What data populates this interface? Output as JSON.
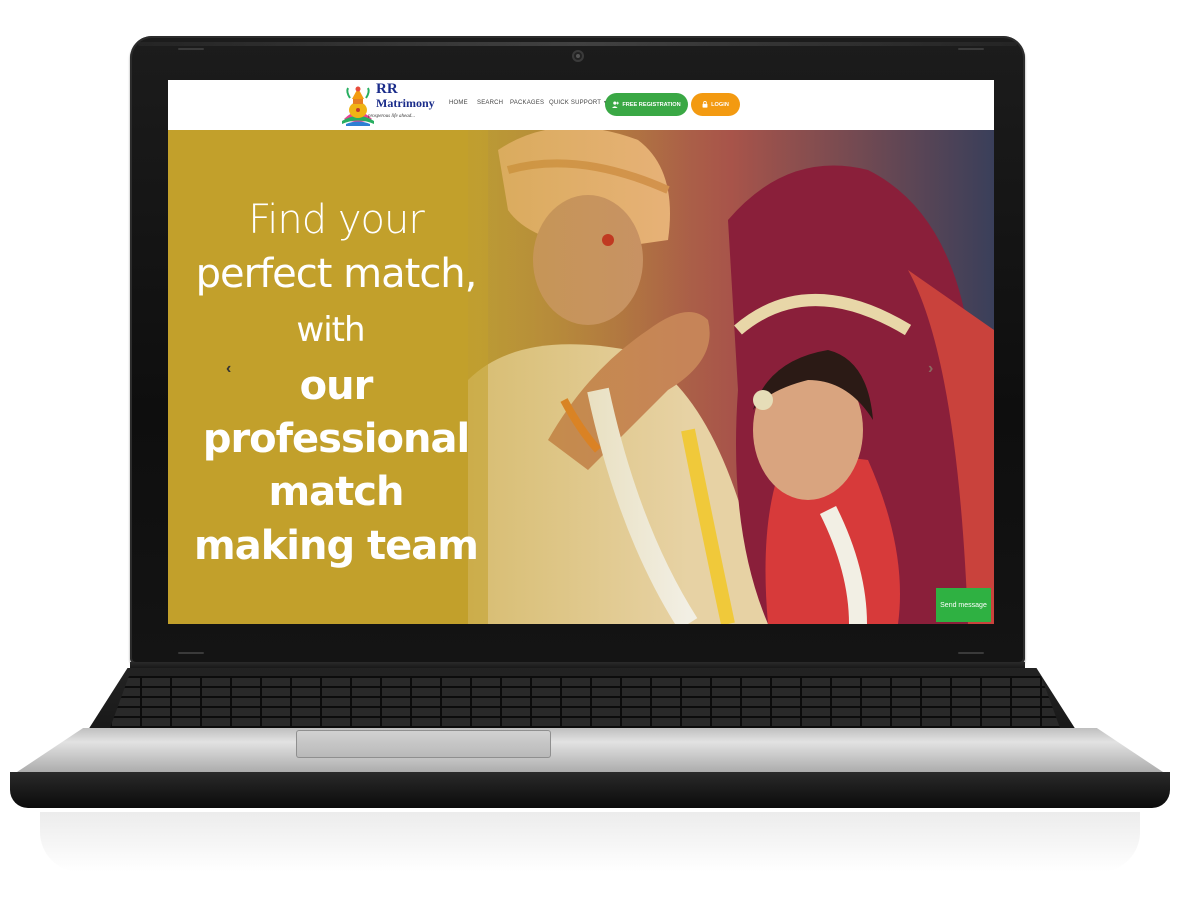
{
  "site": {
    "logo_line1": "RR",
    "logo_line2": "Matrimony",
    "logo_tagline": "prosperous life ahead..."
  },
  "nav": {
    "items": [
      {
        "label": "HOME"
      },
      {
        "label": "SEARCH"
      },
      {
        "label": "PACKAGES"
      },
      {
        "label": "QUICK SUPPORT"
      }
    ],
    "register_label": "FREE REGISTRATION",
    "login_label": "LOGIN"
  },
  "hero": {
    "line1": "Find your",
    "line2": "perfect match,",
    "line3": "with",
    "line4": "our",
    "line5": "professional",
    "line6": "match",
    "line7": "making team",
    "prev_arrow": "‹",
    "next_arrow": "›"
  },
  "chat": {
    "send_label": "Send message"
  },
  "colors": {
    "hero_bg": "#c2a02c",
    "register_btn": "#3aa845",
    "login_btn": "#f39a11",
    "send_btn": "#2fb142",
    "logo_text": "#1a2c8a"
  }
}
